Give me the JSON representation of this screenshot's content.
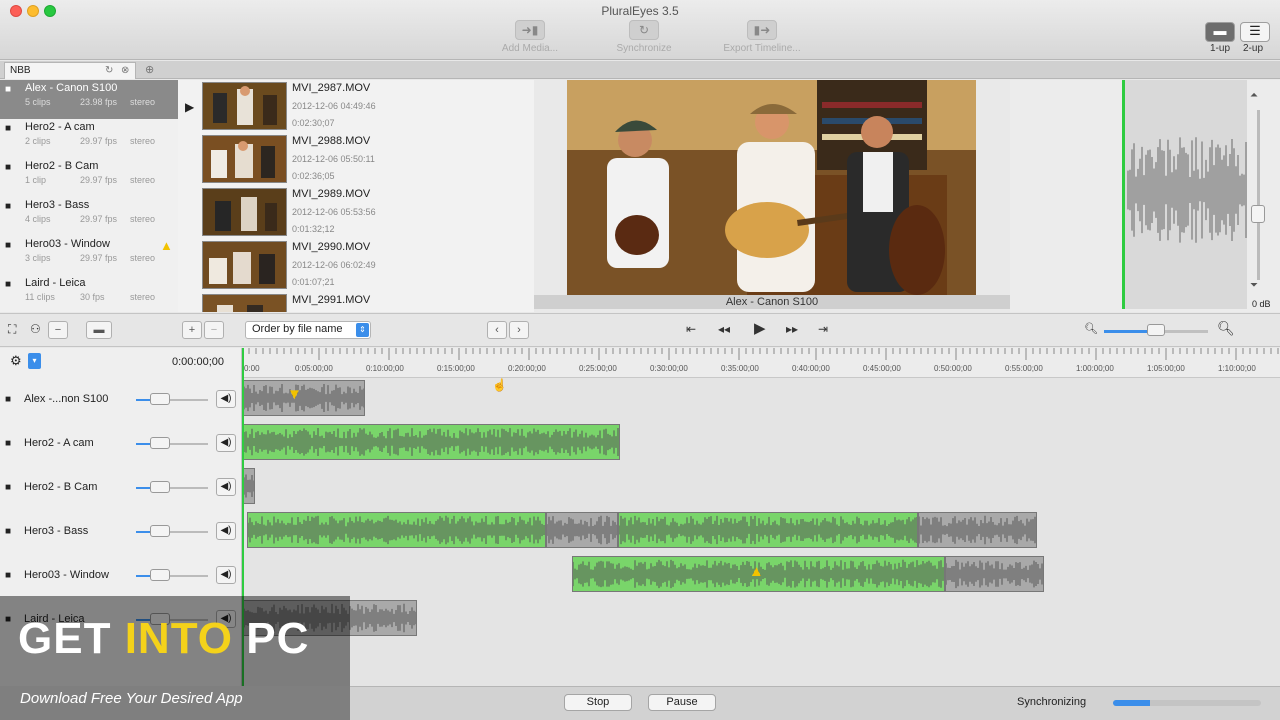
{
  "window": {
    "title": "PluralEyes 3.5"
  },
  "toolbar": {
    "add_media": "Add Media...",
    "synchronize": "Synchronize",
    "export_timeline": "Export Timeline...",
    "layout_1up": "1-up",
    "layout_2up": "2-up"
  },
  "tab": {
    "label": "NBB"
  },
  "sources": [
    {
      "name": "Alex - Canon S100",
      "clips": "5 clips",
      "fps": "23.98 fps",
      "audio": "stereo"
    },
    {
      "name": "Hero2 - A cam",
      "clips": "2 clips",
      "fps": "29.97 fps",
      "audio": "stereo"
    },
    {
      "name": "Hero2 - B Cam",
      "clips": "1 clip",
      "fps": "29.97 fps",
      "audio": "stereo"
    },
    {
      "name": "Hero3 - Bass",
      "clips": "4 clips",
      "fps": "29.97 fps",
      "audio": "stereo"
    },
    {
      "name": "Hero03 - Window",
      "clips": "3 clips",
      "fps": "29.97 fps",
      "audio": "stereo"
    },
    {
      "name": "Laird - Leica",
      "clips": "11 clips",
      "fps": "30 fps",
      "audio": "stereo"
    }
  ],
  "clips": [
    {
      "name": "MVI_2987.MOV",
      "date": "2012-12-06 04:49:46",
      "duration": "0:02:30;07"
    },
    {
      "name": "MVI_2988.MOV",
      "date": "2012-12-06 05:50:11",
      "duration": "0:02:36;05"
    },
    {
      "name": "MVI_2989.MOV",
      "date": "2012-12-06 05:53:56",
      "duration": "0:01:32;12"
    },
    {
      "name": "MVI_2990.MOV",
      "date": "2012-12-06 06:02:49",
      "duration": "0:01:07;21"
    },
    {
      "name": "MVI_2991.MOV",
      "date": "",
      "duration": ""
    }
  ],
  "viewer": {
    "caption": "Alex - Canon S100",
    "db_label": "0 dB"
  },
  "controls": {
    "order_select": "Order by file name",
    "timecode": "0:00:00;00"
  },
  "ruler_ticks": [
    "0:00",
    "0:05:00;00",
    "0:10:00;00",
    "0:15:00;00",
    "0:20:00;00",
    "0:25:00;00",
    "0:30:00;00",
    "0:35:00;00",
    "0:40:00;00",
    "0:45:00;00",
    "0:50:00;00",
    "0:55:00;00",
    "1:00:00;00",
    "1:05:00;00",
    "1:10:00;00"
  ],
  "tracks": [
    {
      "name": "Alex -...non S100"
    },
    {
      "name": "Hero2 - A cam"
    },
    {
      "name": "Hero2 - B Cam"
    },
    {
      "name": "Hero3 - Bass"
    },
    {
      "name": "Hero03 - Window"
    },
    {
      "name": "Laird - Leica"
    }
  ],
  "watermark": {
    "part1": "GET ",
    "part2": "INTO",
    "part3": " PC",
    "tagline": "Download Free Your Desired App"
  },
  "status": {
    "stop": "Stop",
    "pause": "Pause",
    "state": "Synchronizing",
    "progress": 0.25
  },
  "icons": {
    "camera": "camera-icon",
    "gear": "gear-icon",
    "speaker": "speaker-icon",
    "play": "play-icon",
    "warning": "warning-icon",
    "zoom_in": "zoom-in-icon",
    "zoom_out": "zoom-out-icon"
  },
  "colors": {
    "accent": "#3b8eea",
    "sync_green": "#2ecc40",
    "waveform_green": "#79d56a",
    "warning": "#f2c200"
  }
}
